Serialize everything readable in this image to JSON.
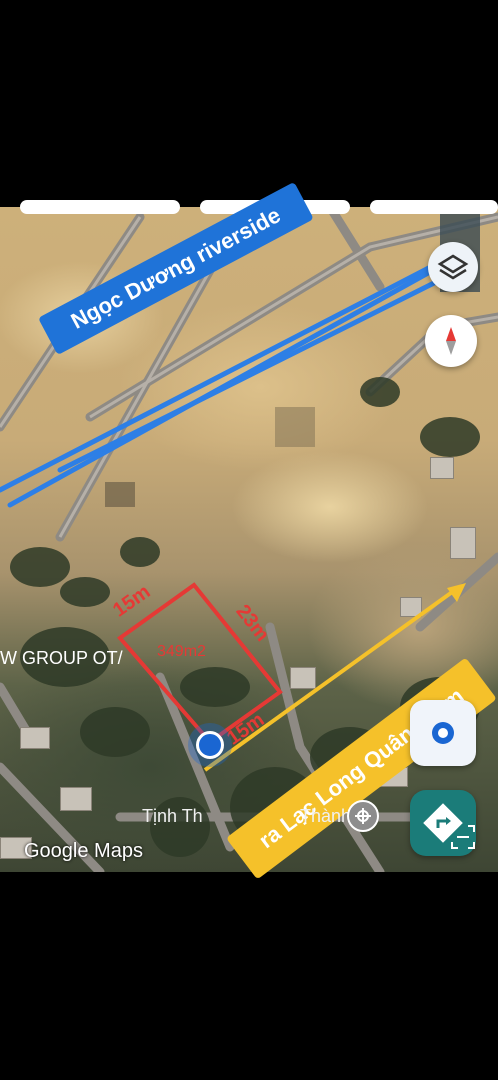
{
  "map": {
    "watermark": "Google Maps",
    "place_label_left": "W GROUP OT/",
    "place_label_bottom": "Tịnh Th",
    "place_label_bottom_end": "Thành"
  },
  "annotations": {
    "blue_label": "Ngọc Dương riverside",
    "yellow_label": "ra Lạc Long Quân 800m",
    "dim_top": "15m",
    "dim_right": "23m",
    "dim_bottom": "15m",
    "area": "349m2"
  },
  "icons": {
    "layers": "layers-icon",
    "compass": "compass-icon",
    "my_location": "my-location-icon",
    "directions": "directions-icon",
    "lens": "lens-icon",
    "temple_marker": "temple-marker-icon"
  },
  "colors": {
    "blue": "#1f73d8",
    "yellow": "#f5c12a",
    "red": "#e53935",
    "teal": "#1b7c79"
  }
}
